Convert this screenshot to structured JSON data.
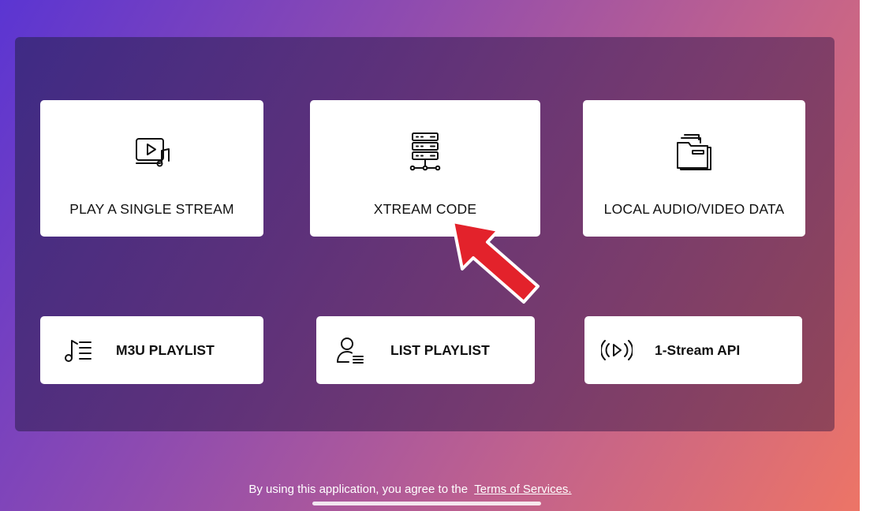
{
  "cards": {
    "single_stream": {
      "label": "PLAY A SINGLE STREAM",
      "icon": "video-music-icon"
    },
    "xtream_code": {
      "label": "XTREAM CODE",
      "icon": "server-icon"
    },
    "local_data": {
      "label": "LOCAL AUDIO/VIDEO DATA",
      "icon": "folder-files-icon"
    },
    "m3u_playlist": {
      "label": "M3U PLAYLIST",
      "icon": "music-list-icon"
    },
    "list_playlist": {
      "label": "LIST PLAYLIST",
      "icon": "user-list-icon"
    },
    "stream_api": {
      "label": "1-Stream API",
      "icon": "broadcast-icon"
    }
  },
  "footer": {
    "text": "By using this application, you agree to the",
    "link": "Terms of Services."
  },
  "colors": {
    "arrow": "#e3222b",
    "card_bg": "#ffffff"
  }
}
